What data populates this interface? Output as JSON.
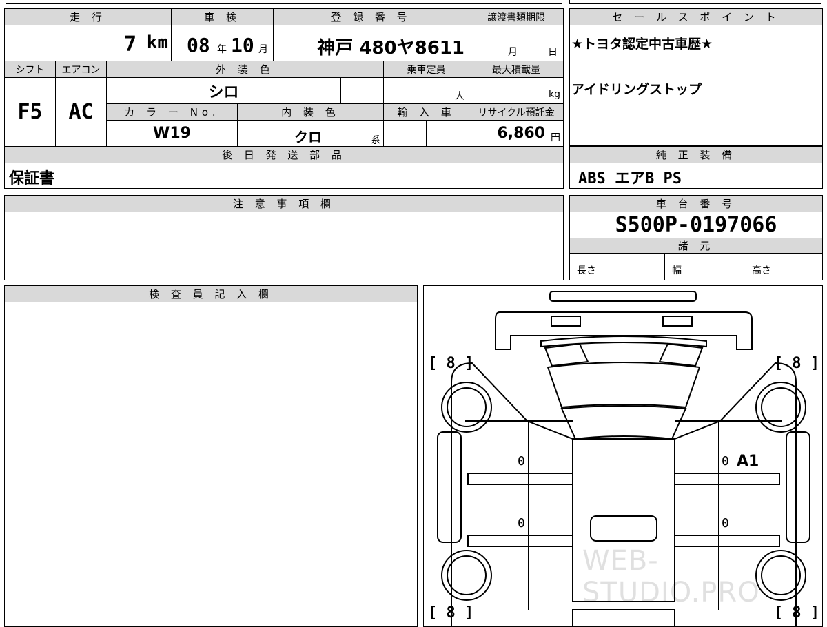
{
  "headers": {
    "mileage": "走 行",
    "inspection": "車 検",
    "registration": "登 録 番 号",
    "transfer_deadline": "譲渡書類期限",
    "sales_point": "セ ー ル ス ポ イ ン ト",
    "shift": "シフト",
    "aircon": "エアコン",
    "exterior_color": "外 装 色",
    "capacity": "乗車定員",
    "max_load": "最大積載量",
    "color_no": "カ ラ ー No.",
    "interior_color": "内 装 色",
    "import": "輸 入 車",
    "recycle": "リサイクル預託金",
    "later_parts": "後 日 発 送 部 品",
    "genuine_equipment": "純 正 装 備",
    "notes": "注 意 事 項 欄",
    "chassis_number": "車 台 番 号",
    "specs": "諸 元",
    "inspector": "検 査 員 記 入 欄"
  },
  "values": {
    "mileage_num": "7",
    "mileage_unit": "km",
    "inspection_year": "08",
    "year_unit": "年",
    "inspection_month": "10",
    "month_unit": "月",
    "registration_number": "神戸 480ヤ8611",
    "transfer_month": "月",
    "transfer_day": "日",
    "sales_point_1": "★トヨタ認定中古車歴★",
    "sales_point_2": "アイドリングストップ",
    "shift": "F5",
    "aircon": "AC",
    "exterior_color": "シロ",
    "capacity_unit": "人",
    "max_load_unit": "kg",
    "color_no": "W19",
    "interior_color": "クロ",
    "interior_suffix": "系",
    "recycle_amount": "6,860",
    "recycle_unit": "円",
    "later_parts": "保証書",
    "genuine_equipment": "ABS エアB PS",
    "chassis_number": "S500P-0197066",
    "length_label": "長さ",
    "width_label": "幅",
    "height_label": "高さ"
  },
  "diagram": {
    "tire_fl": "[ 8 ]",
    "tire_fr": "[ 8 ]",
    "tire_rl": "[ 8 ]",
    "tire_rr": "[ 8 ]",
    "mark_0a": "0",
    "mark_0b": "0",
    "mark_0c": "0",
    "mark_0d": "0",
    "damage_code": "A1",
    "watermark": "WEB-STUDIO.PRO"
  }
}
